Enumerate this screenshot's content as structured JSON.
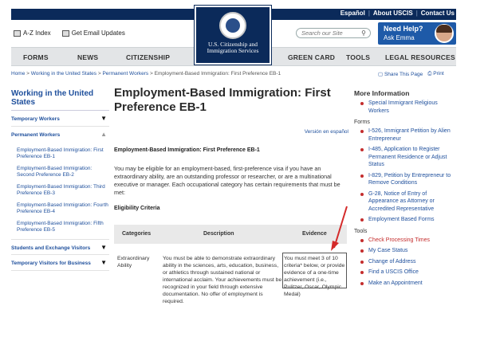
{
  "topbar": {
    "links": [
      "Español",
      "About USCIS",
      "Contact Us"
    ]
  },
  "utility": {
    "az_index": "A-Z Index",
    "email_updates": "Get Email Updates"
  },
  "logo": {
    "line1": "U.S. Citizenship and",
    "line2": "Immigration Services"
  },
  "search": {
    "placeholder": "Search our Site"
  },
  "help": {
    "title": "Need Help?",
    "subtitle": "Ask Emma"
  },
  "nav": {
    "items": [
      "FORMS",
      "NEWS",
      "CITIZENSHIP",
      "GREEN CARD",
      "TOOLS",
      "LEGAL RESOURCES"
    ]
  },
  "breadcrumb": {
    "home": "Home",
    "working": "Working in the United States",
    "permanent": "Permanent Workers",
    "current": "Employment-Based Immigration: First Preference EB-1",
    "sep": " > "
  },
  "share": {
    "share": "Share This Page",
    "print": "Print"
  },
  "sidebar": {
    "title": "Working in the United States",
    "categories": [
      "Temporary Workers",
      "Permanent Workers",
      "Students and Exchange Visitors",
      "Temporary Visitors for Business"
    ],
    "sub_items": [
      "Employment-Based Immigration: First Preference EB-1",
      "Employment-Based Immigration: Second Preference EB-2",
      "Employment-Based Immigration: Third Preference EB-3",
      "Employment-Based Immigration: Fourth Preference EB-4",
      "Employment-Based Immigration: Fifth Preference EB-5"
    ]
  },
  "main": {
    "title": "Employment-Based Immigration: First Preference EB-1",
    "version": "Versión en español",
    "subheading": "Employment-Based Immigration: First Preference EB-1",
    "paragraph": "You may be eligible for an employment-based, first-preference visa if you have an extraordinary ability, are an outstanding professor or researcher, or are a multinational executive or manager. Each occupational category has certain requirements that must be met:",
    "eligibility": "Eligibility Criteria"
  },
  "table": {
    "headers": [
      "Categories",
      "Description",
      "Evidence"
    ],
    "row": {
      "category": "Extraordinary Ability",
      "description": "You must be able to demonstrate extraordinary ability in the sciences, arts, education, business, or athletics through sustained national or international acclaim. Your achievements must be recognized in your field through extensive documentation. No offer of employment is required.",
      "evidence": "You must meet 3 of 10 criteria* below, or provide evidence of a one-time achievement (i.e., Pulitzer, Oscar, Olympic Medal)"
    }
  },
  "right": {
    "more_info": "More Information",
    "more_info_items": [
      "Special Immigrant Religious Workers"
    ],
    "forms_title": "Forms",
    "forms": [
      "I-526, Immigrant Petition by Alien Entrepreneur",
      "I-485, Application to Register Permanent Residence or Adjust Status",
      "I-829, Petition by Entrepreneur to Remove Conditions",
      "G-28, Notice of Entry of Appearance as Attorney or Accredited Representative",
      "Employment Based Forms"
    ],
    "tools_title": "Tools",
    "tools": [
      "Check Processing Times",
      "My Case Status",
      "Change of Address",
      "Find a USCIS Office",
      "Make an Appointment"
    ]
  },
  "colors": {
    "brand_navy": "#0b2a5a",
    "link_blue": "#1e4f9c",
    "alert_red": "#c42d2d",
    "help_blue": "#1e5aa8"
  }
}
